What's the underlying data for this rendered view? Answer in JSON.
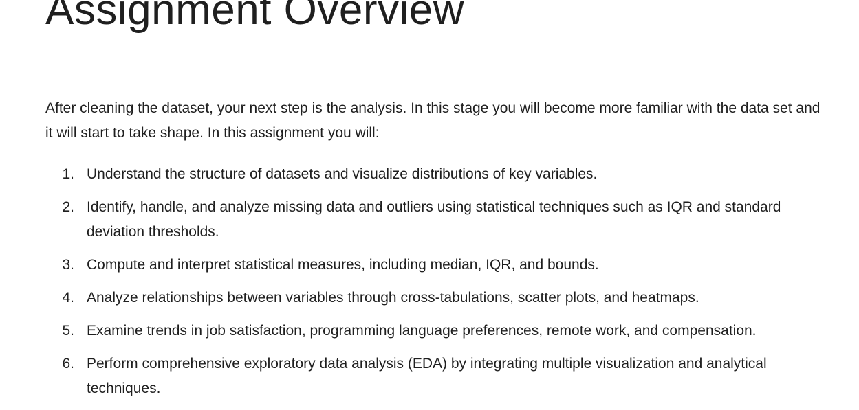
{
  "document": {
    "title": "Assignment Overview",
    "intro": "After cleaning the dataset, your next step is the analysis. In this stage you will become more familiar with the data set and it will start to take shape. In this assignment you will:",
    "objectives": [
      {
        "number": "1.",
        "text": "Understand the structure of datasets and visualize distributions of key variables."
      },
      {
        "number": "2.",
        "text": "Identify, handle, and analyze missing data and outliers using statistical techniques such as IQR and standard deviation thresholds."
      },
      {
        "number": "3.",
        "text": "Compute and interpret statistical measures, including median, IQR, and bounds."
      },
      {
        "number": "4.",
        "text": "Analyze relationships between variables through cross-tabulations, scatter plots, and heatmaps."
      },
      {
        "number": "5.",
        "text": "Examine trends in job satisfaction, programming language preferences, remote work, and compensation."
      },
      {
        "number": "6.",
        "text": "Perform comprehensive exploratory data analysis (EDA) by integrating multiple visualization and analytical techniques."
      }
    ]
  }
}
